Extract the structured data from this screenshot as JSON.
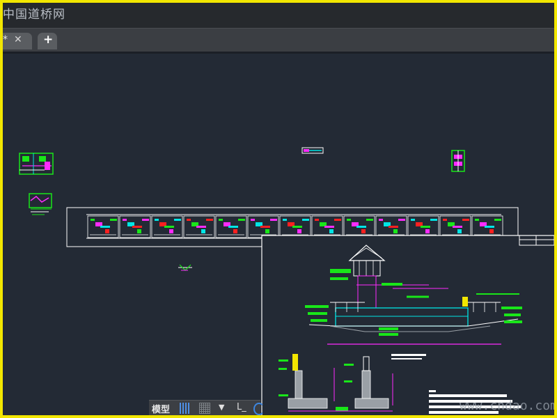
{
  "watermark_top": "中国道桥网",
  "tabs": [
    {
      "label": "*",
      "close": "✕"
    },
    {
      "label": "+"
    }
  ],
  "status": {
    "model_tab": "模型",
    "dropdown": "▼",
    "ortho": "L_"
  },
  "watermark_bottom": "www.cndao.com",
  "colors": {
    "frame": "#f2e600",
    "model_space": "#232a35",
    "green": "#19e619",
    "magenta": "#ff2bff",
    "cyan": "#00e5e5",
    "white": "#ffffff"
  },
  "icons": [
    "close-icon",
    "plus-icon",
    "grid-icon",
    "snap-icon",
    "chevron-down-icon",
    "ortho-icon",
    "polar-icon"
  ]
}
